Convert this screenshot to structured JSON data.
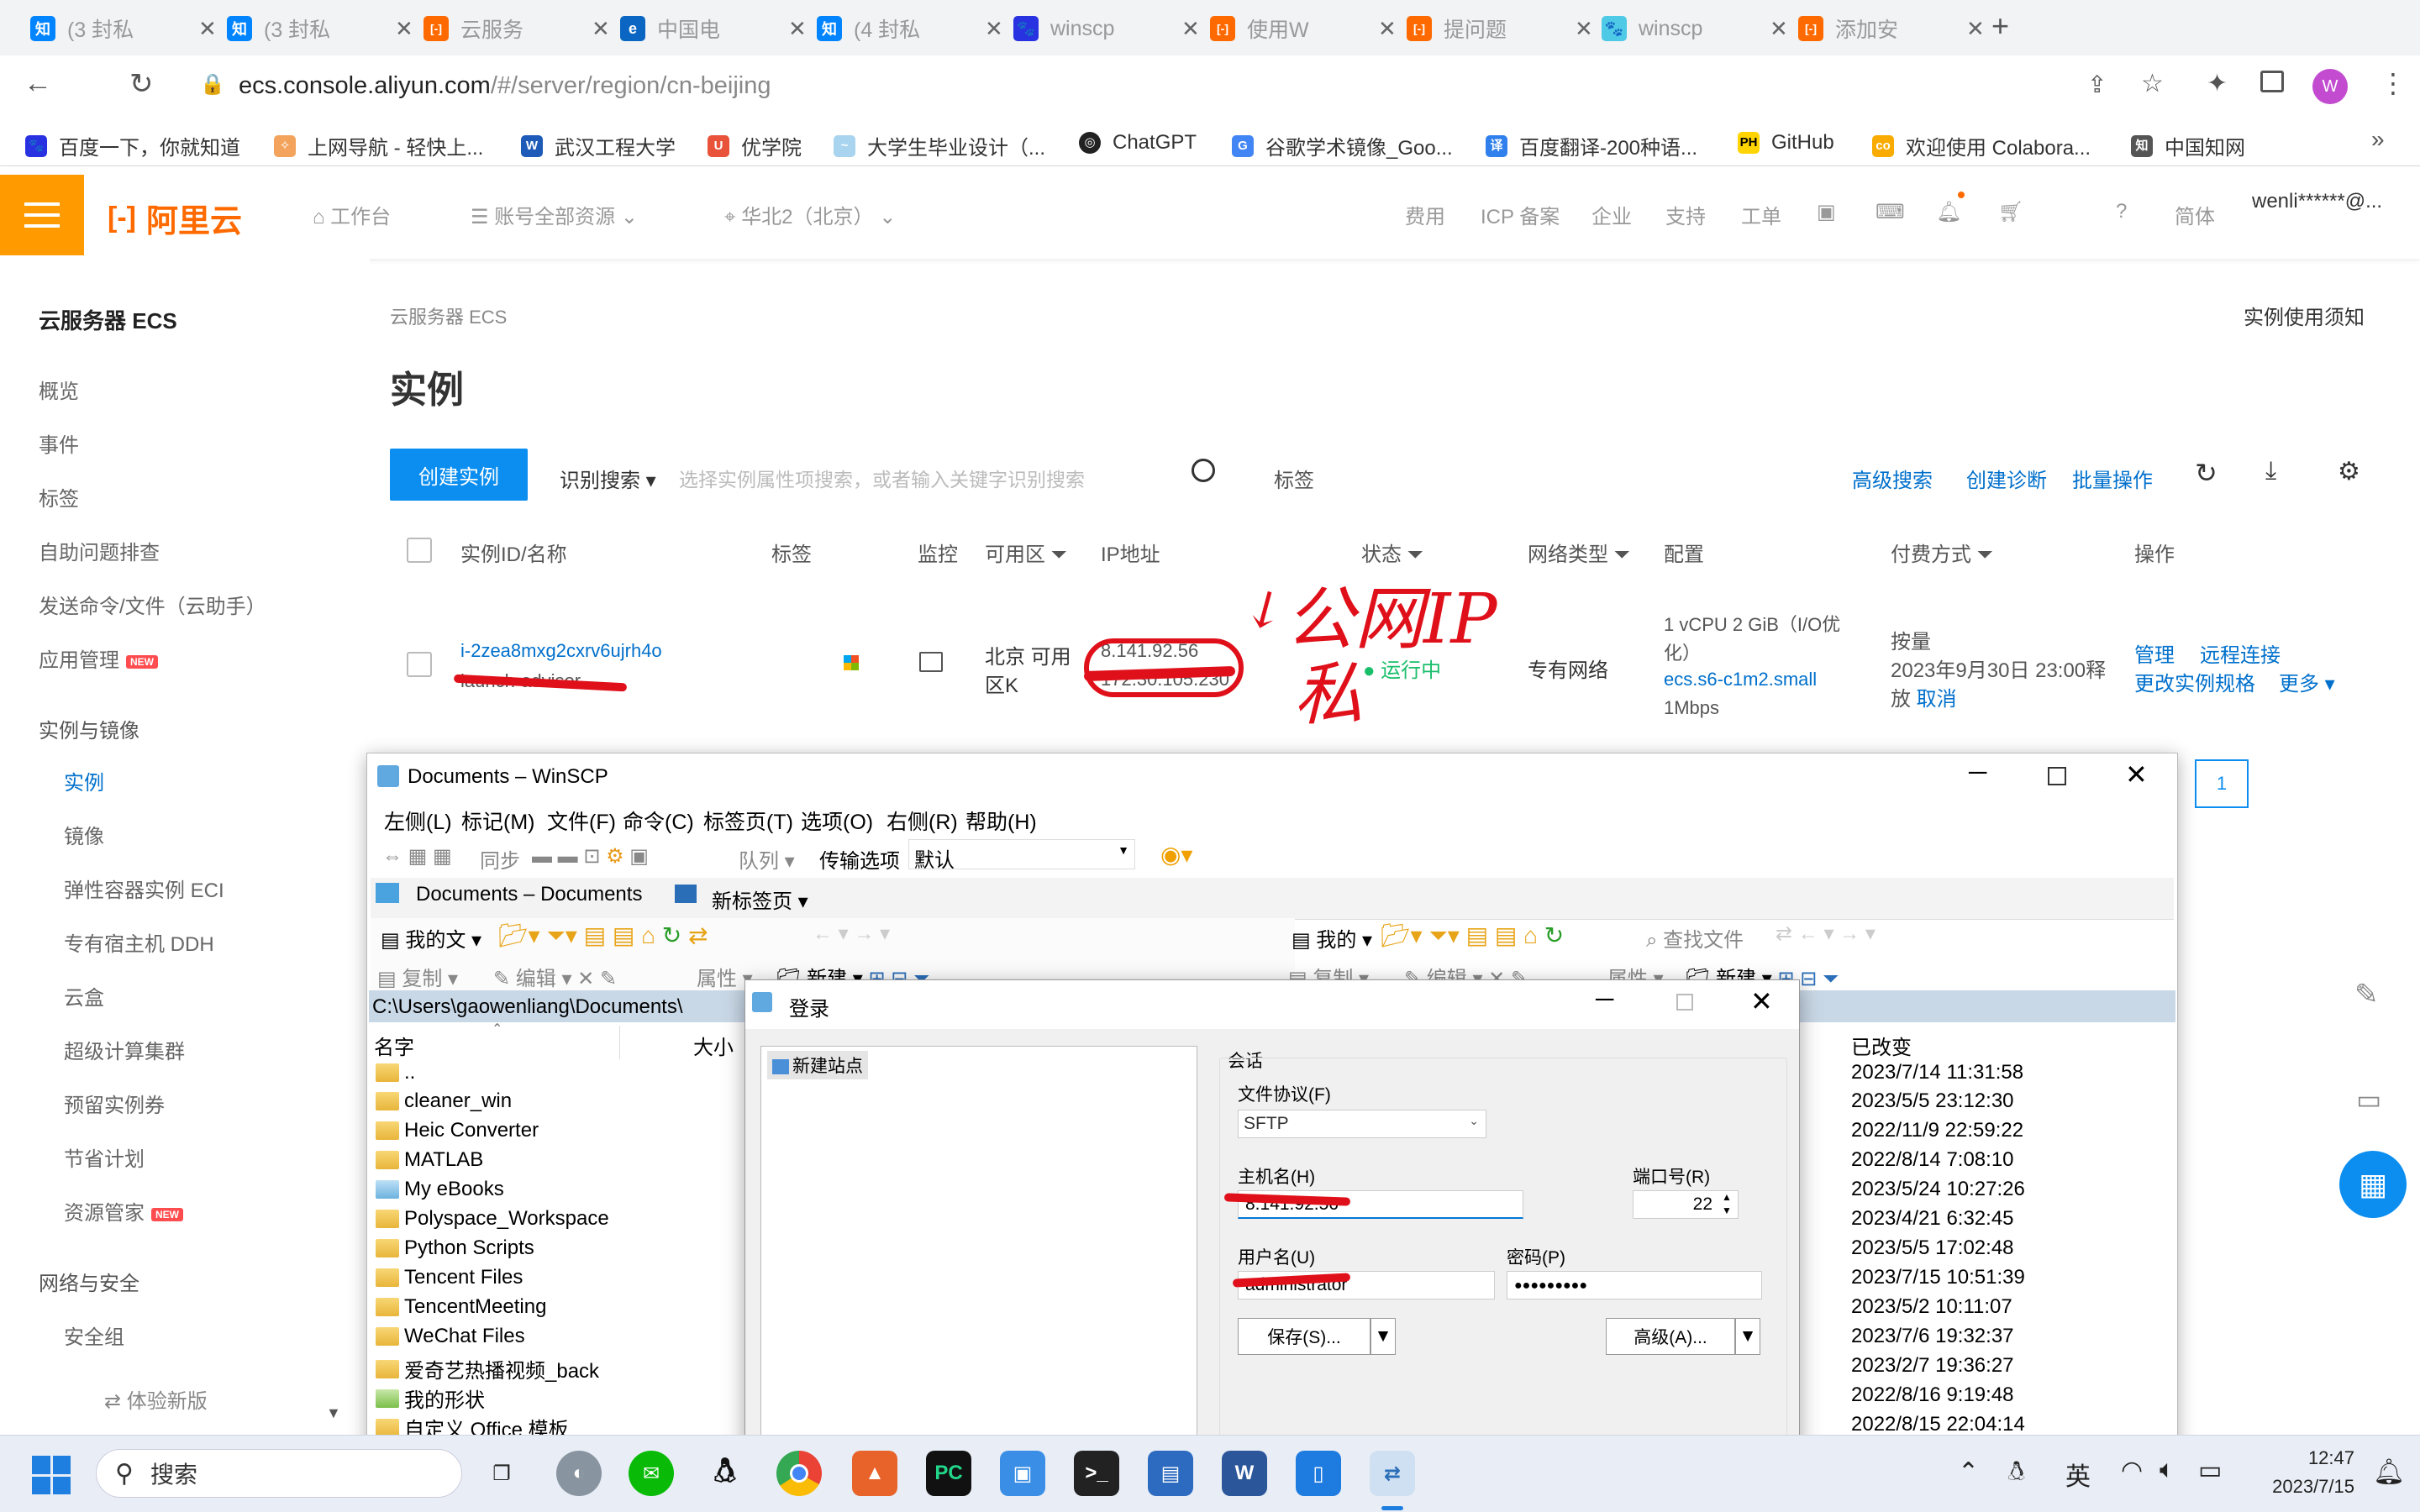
{
  "browser": {
    "tabs": [
      {
        "label": "(3 封私",
        "icon": "zhihu-icon"
      },
      {
        "label": "(3 封私",
        "icon": "zhihu-icon"
      },
      {
        "label": "云服务",
        "icon": "aliyun-icon"
      },
      {
        "label": "中国电",
        "icon": "telecom-icon"
      },
      {
        "label": "(4 封私",
        "icon": "zhihu-icon"
      },
      {
        "label": "winscp",
        "icon": "baidu-icon"
      },
      {
        "label": "使用W",
        "icon": "aliyun-icon"
      },
      {
        "label": "提问题",
        "icon": "aliyun-icon"
      },
      {
        "label": "winscp",
        "icon": "baidu-icon"
      },
      {
        "label": "添加安",
        "icon": "aliyun-icon"
      }
    ],
    "url_host": "ecs.console.aliyun.com",
    "url_path": "/#/server/region/cn-beijing",
    "profile_initial": "W",
    "bookmarks": [
      "百度一下，你就知道",
      "上网导航 - 轻快上...",
      "武汉工程大学",
      "优学院",
      "大学生毕业设计（...",
      "ChatGPT",
      "谷歌学术镜像_Goo...",
      "百度翻译-200种语...",
      "GitHub",
      "欢迎使用 Colabora...",
      "中国知网"
    ]
  },
  "aliyun": {
    "logo_text": "阿里云",
    "nav": {
      "workbench": "工作台",
      "resources": "账号全部资源",
      "region": "华北2（北京）",
      "right": [
        "费用",
        "ICP 备案",
        "企业",
        "支持",
        "工单"
      ],
      "lang": "简体",
      "account": "wenli******@..."
    },
    "sidebar": {
      "title": "云服务器 ECS",
      "items": [
        "概览",
        "事件",
        "标签",
        "自助问题排查",
        "发送命令/文件（云助手）",
        "应用管理"
      ],
      "new_badge": "NEW",
      "section1": "实例与镜像",
      "sub_items": [
        "实例",
        "镜像",
        "弹性容器实例 ECI",
        "专有宿主机 DDH",
        "云盒",
        "超级计算集群",
        "预留实例券",
        "节省计划",
        "资源管家"
      ],
      "section2": "网络与安全",
      "sub_items2": [
        "安全组"
      ],
      "trial": "体验新版"
    },
    "main": {
      "breadcrumb": "云服务器 ECS",
      "notice_link": "实例使用须知",
      "title": "实例",
      "create_button": "创建实例",
      "search_mode": "识别搜索",
      "search_placeholder": "选择实例属性项搜索，或者输入关键字识别搜索",
      "tag_filter": "标签",
      "advanced_search": "高级搜索",
      "create_diag": "创建诊断",
      "batch_ops": "批量操作",
      "columns": [
        "实例ID/名称",
        "标签",
        "监控",
        "可用区",
        "IP地址",
        "状态",
        "网络类型",
        "配置",
        "付费方式",
        "操作"
      ],
      "row": {
        "id": "i-2zea8mxg2cxrv6ujrh4o",
        "name": "launch-advisor",
        "zone_line1": "北京 可用",
        "zone_line2": "区K",
        "ip_public": "8.141.92.56",
        "ip_private": "172.30.105.230",
        "status": "运行中",
        "network": "专有网络",
        "config_line1": "1 vCPU 2 GiB（I/O优",
        "config_line2": "化）",
        "config_spec": "ecs.s6-c1m2.small",
        "config_bw": "1Mbps",
        "pay_type": "按量",
        "pay_release": "2023年9月30日 23:00释",
        "pay_release2": "放",
        "pay_cancel": "取消",
        "op_manage": "管理",
        "op_remote": "远程连接",
        "op_change": "更改实例规格",
        "op_more": "更多"
      },
      "pager": "1",
      "annotation_public": "公网IP",
      "annotation_private": "私"
    }
  },
  "winscp": {
    "title": "Documents – WinSCP",
    "menu": [
      "左侧(L)",
      "标记(M)",
      "文件(F)",
      "命令(C)",
      "标签页(T)",
      "选项(O)",
      "右侧(R)",
      "帮助(H)"
    ],
    "sync": "同步",
    "queue": "队列",
    "transfer_label": "传输选项",
    "transfer_value": "默认",
    "tab_docs": "Documents – Documents",
    "tab_new": "新标签页",
    "left_location": "我的文",
    "right_location": "我的",
    "find_files": "查找文件",
    "copy": "复制",
    "edit": "编辑",
    "properties": "属性",
    "new": "新建",
    "path": "C:\\Users\\gaowenliang\\Documents\\",
    "col_name": "名字",
    "col_size": "大小",
    "col_changed": "已改变",
    "files": [
      "..",
      "cleaner_win",
      "Heic Converter",
      "MATLAB",
      "My eBooks",
      "Polyspace_Workspace",
      "Python Scripts",
      "Tencent Files",
      "TencentMeeting",
      "WeChat Files",
      "爱奇艺热播视频_back",
      "我的形状",
      "自定义 Office 模板"
    ],
    "dates": [
      "2023/7/14 11:31:58",
      "2023/5/5 23:12:30",
      "2022/11/9 22:59:22",
      "2022/8/14 7:08:10",
      "2023/5/24 10:27:26",
      "2023/4/21 6:32:45",
      "2023/5/5 17:02:48",
      "2023/7/15 10:51:39",
      "2023/5/2 10:11:07",
      "2023/7/6 19:32:37",
      "2023/2/7 19:36:27",
      "2022/8/16 9:19:48",
      "2022/8/15 22:04:14"
    ]
  },
  "login": {
    "title": "登录",
    "site": "新建站点",
    "session": "会话",
    "protocol_label": "文件协议(F)",
    "protocol_value": "SFTP",
    "host_label": "主机名(H)",
    "host_value": "8.141.92.56",
    "port_label": "端口号(R)",
    "port_value": "22",
    "user_label": "用户名(U)",
    "user_value": "administrator",
    "pass_label": "密码(P)",
    "pass_value": "●●●●●●●●●",
    "save_button": "保存(S)...",
    "advanced_button": "高级(A)..."
  },
  "taskbar": {
    "search": "搜索",
    "ime": "英",
    "time": "12:47",
    "date": "2023/7/15"
  }
}
